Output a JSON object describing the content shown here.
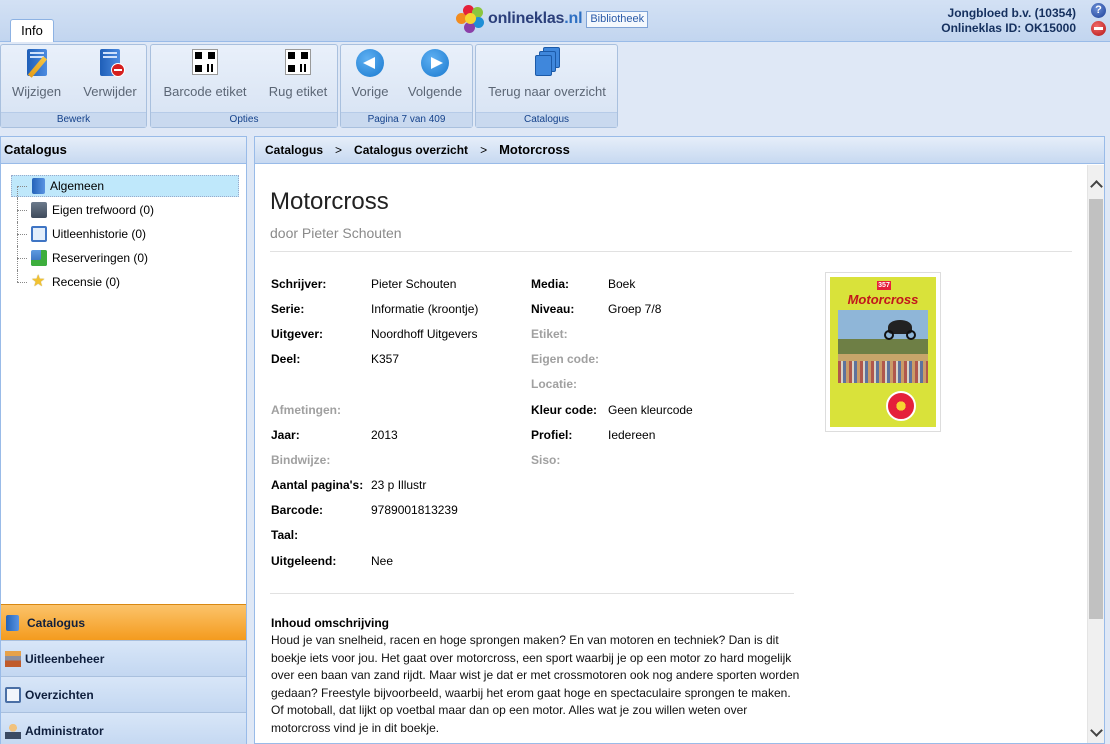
{
  "header": {
    "info_tab": "Info",
    "logo_brand": "onlineklas",
    "logo_tld": ".nl",
    "logo_badge": "Bibliotheek",
    "account_name": "Jongbloed b.v. (10354)",
    "account_id": "Onlineklas ID: OK15000",
    "icons": [
      "help-icon",
      "logout-icon"
    ]
  },
  "ribbon": {
    "groups": [
      {
        "label": "Bewerk",
        "buttons": [
          {
            "label": "Wijzigen",
            "icon": "edit-book-icon"
          },
          {
            "label": "Verwijder",
            "icon": "delete-book-icon"
          }
        ]
      },
      {
        "label": "Opties",
        "buttons": [
          {
            "label": "Barcode etiket",
            "icon": "qr-code-icon"
          },
          {
            "label": "Rug etiket",
            "icon": "qr-code-icon"
          }
        ]
      },
      {
        "label": "Pagina 7 van 409",
        "buttons": [
          {
            "label": "Vorige",
            "icon": "arrow-left-icon"
          },
          {
            "label": "Volgende",
            "icon": "arrow-right-icon"
          }
        ]
      },
      {
        "label": "Catalogus",
        "buttons": [
          {
            "label": "Terug naar overzicht",
            "icon": "books-stack-icon"
          }
        ]
      }
    ]
  },
  "sidebar": {
    "title": "Catalogus",
    "tree": [
      {
        "label": "Algemeen",
        "icon": "book-icon",
        "selected": true
      },
      {
        "label": "Eigen trefwoord (0)",
        "icon": "keyword-icon"
      },
      {
        "label": "Uitleenhistorie (0)",
        "icon": "history-icon"
      },
      {
        "label": "Reserveringen (0)",
        "icon": "reservation-icon"
      },
      {
        "label": "Recensie (0)",
        "icon": "star-icon"
      }
    ],
    "accordion": [
      {
        "label": "Catalogus",
        "icon": "book-icon",
        "active": true
      },
      {
        "label": "Uitleenbeheer",
        "icon": "loan-icon"
      },
      {
        "label": "Overzichten",
        "icon": "overview-icon"
      },
      {
        "label": "Administrator",
        "icon": "admin-icon"
      }
    ]
  },
  "breadcrumb": [
    "Catalogus",
    "Catalogus overzicht",
    "Motorcross"
  ],
  "book": {
    "title": "Motorcross",
    "author_line": "door Pieter Schouten",
    "left_fields": [
      {
        "key": "Schrijver:",
        "value": "Pieter Schouten"
      },
      {
        "key": "Serie:",
        "value": "Informatie (kroontje)"
      },
      {
        "key": "Uitgever:",
        "value": "Noordhoff Uitgevers"
      },
      {
        "key": "Deel:",
        "value": "K357"
      },
      {
        "key": "",
        "value": ""
      },
      {
        "key": "Afmetingen:",
        "value": "",
        "muted": true
      },
      {
        "key": "Jaar:",
        "value": "2013"
      },
      {
        "key": "Bindwijze:",
        "value": "",
        "muted": true
      },
      {
        "key": "Aantal pagina's:",
        "value": "23 p Illustr"
      },
      {
        "key": "Barcode:",
        "value": "9789001813239"
      },
      {
        "key": "Taal:",
        "value": ""
      },
      {
        "key": "Uitgeleend:",
        "value": "Nee"
      }
    ],
    "right_fields": [
      {
        "key": "Media:",
        "value": "Boek"
      },
      {
        "key": "Niveau:",
        "value": "Groep 7/8"
      },
      {
        "key": "Etiket:",
        "value": "",
        "muted": true
      },
      {
        "key": "Eigen code:",
        "value": "",
        "muted": true
      },
      {
        "key": "Locatie:",
        "value": "",
        "muted": true
      },
      {
        "key": "Kleur code:",
        "value": "Geen kleurcode"
      },
      {
        "key": "Profiel:",
        "value": "Iedereen"
      },
      {
        "key": "Siso:",
        "value": "",
        "muted": true
      }
    ],
    "cover": {
      "number": "357",
      "title": "Motorcross"
    },
    "description_title": "Inhoud omschrijving",
    "description": "Houd je van snelheid, racen en hoge sprongen maken? En van motoren en techniek? Dan is dit boekje iets voor jou. Het gaat over motorcross, een sport waarbij je op een motor zo hard mogelijk over een baan van zand rijdt. Maar wist je dat er met crossmotoren ook nog andere sporten worden gedaan? Freestyle bijvoorbeeld, waarbij het erom gaat hoge en spectaculaire sprongen te maken. Of motoball, dat lijkt op voetbal maar dan op een motor. Alles wat je zou willen weten over motorcross vind je in dit boekje."
  },
  "colors": {
    "accent_orange": "#f49b1e",
    "header_blue": "#c2d5ef",
    "selected_row": "#bfe8fb"
  }
}
